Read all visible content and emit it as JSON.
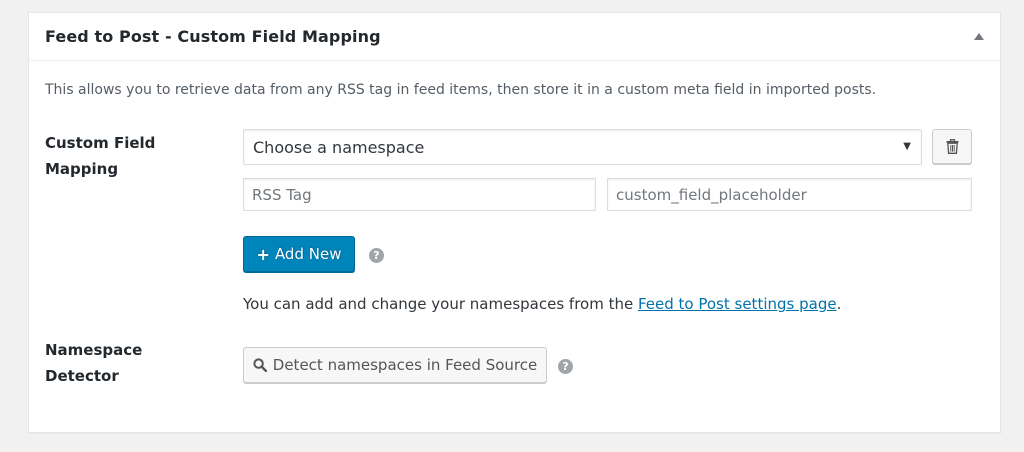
{
  "metabox": {
    "title": "Feed to Post - Custom Field Mapping",
    "toggle_icon": "arrow-up-icon",
    "description": "This allows you to retrieve data from any RSS tag in feed items, then store it in a custom meta field in imported posts."
  },
  "mapping": {
    "label": "Custom Field Mapping",
    "namespace_select": {
      "selected": "Choose a namespace",
      "caret": "▼"
    },
    "delete_icon": "trash-icon",
    "rss_tag_input": {
      "value": "",
      "placeholder": "RSS Tag"
    },
    "custom_field_input": {
      "value": "",
      "placeholder": "custom_field_placeholder"
    },
    "add_new": {
      "icon": "plus",
      "label": "Add New"
    },
    "help_icon": "?",
    "note": {
      "text": "You can add and change your namespaces from the ",
      "link_text": "Feed to Post settings page",
      "suffix": "."
    }
  },
  "detector": {
    "label": "Namespace Detector",
    "button_label": "Detect namespaces in Feed Source",
    "help_icon": "?"
  },
  "colors": {
    "primary": "#0085ba",
    "link": "#0073aa",
    "background": "#f1f1f1"
  }
}
